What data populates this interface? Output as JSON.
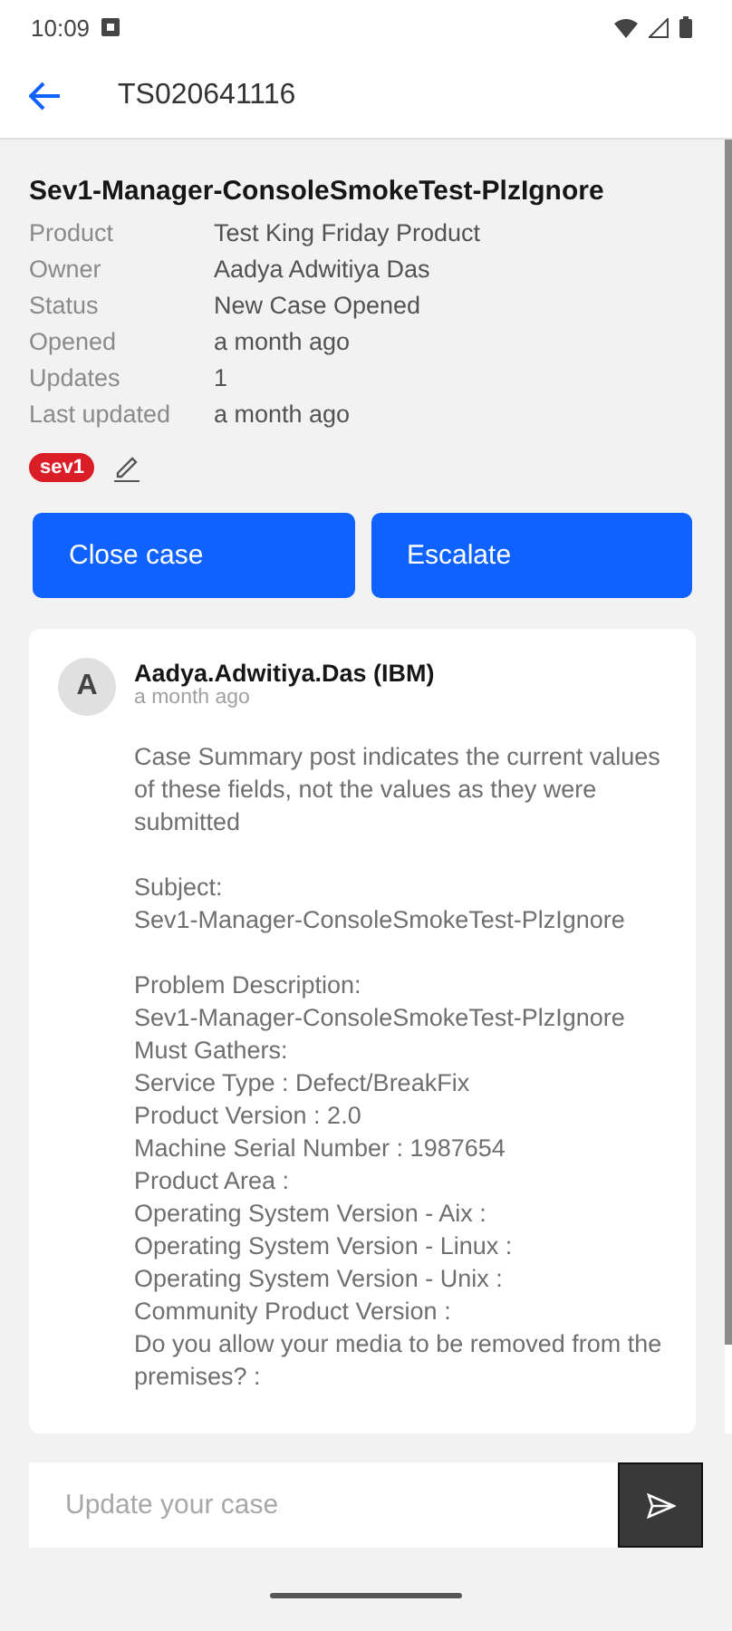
{
  "status_bar": {
    "time": "10:09"
  },
  "app_bar": {
    "title": "TS020641116"
  },
  "case": {
    "title": "Sev1-Manager-ConsoleSmokeTest-PlzIgnore",
    "fields": [
      {
        "label": "Product",
        "value": "Test King Friday Product"
      },
      {
        "label": "Owner",
        "value": "Aadya Adwitiya Das"
      },
      {
        "label": "Status",
        "value": "New Case Opened"
      },
      {
        "label": "Opened",
        "value": "a month ago"
      },
      {
        "label": "Updates",
        "value": "1"
      },
      {
        "label": "Last updated",
        "value": "a month ago"
      }
    ],
    "severity": "sev1"
  },
  "actions": [
    "Close case",
    "Escalate"
  ],
  "post": {
    "avatar": "A",
    "author": "Aadya.Adwitiya.Das (IBM)",
    "time": "a month ago",
    "paragraphs": [
      [
        "Case Summary post indicates the current values of these fields, not the values as they were submitted"
      ],
      [
        "Subject:",
        "Sev1-Manager-ConsoleSmokeTest-PlzIgnore"
      ],
      [
        "Problem Description:",
        "Sev1-Manager-ConsoleSmokeTest-PlzIgnore",
        "Must Gathers:",
        "Service Type : Defect/BreakFix",
        "Product Version : 2.0",
        "Machine Serial Number : 1987654",
        "Product Area :",
        "Operating System Version - Aix :",
        "Operating System Version - Linux :",
        "Operating System Version - Unix :",
        "Community Product Version :",
        "Do you allow your media to be removed from the premises? :"
      ]
    ]
  },
  "composer": {
    "placeholder": "Update your case"
  }
}
